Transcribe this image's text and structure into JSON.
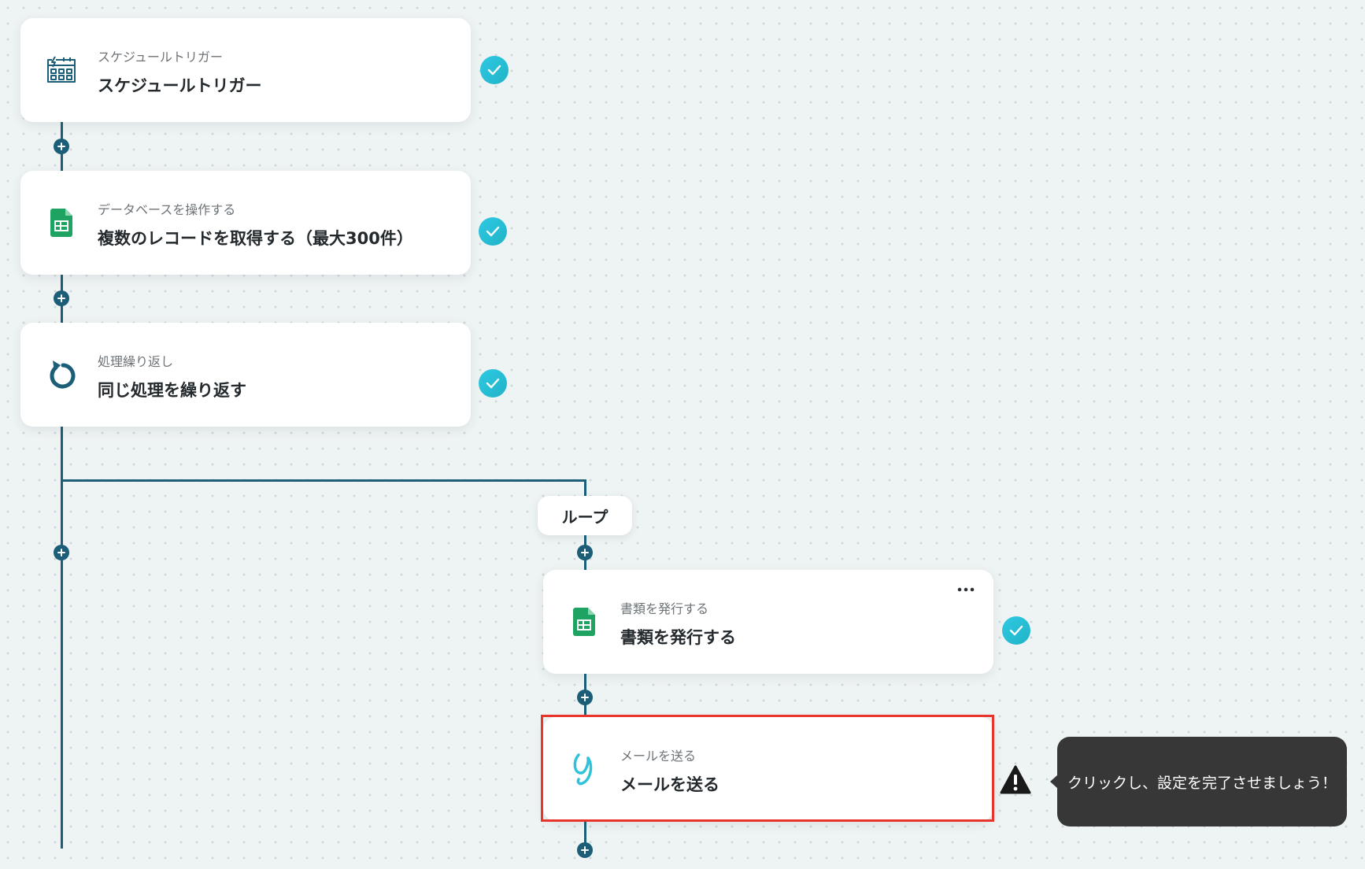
{
  "flow": {
    "steps": [
      {
        "subtitle": "スケジュールトリガー",
        "title": "スケジュールトリガー",
        "icon": "schedule-trigger-icon",
        "status": "complete"
      },
      {
        "subtitle": "データベースを操作する",
        "title": "複数のレコードを取得する（最大300件）",
        "icon": "google-sheets-icon",
        "status": "complete"
      },
      {
        "subtitle": "処理繰り返し",
        "title": "同じ処理を繰り返す",
        "icon": "loop-repeat-icon",
        "status": "complete"
      }
    ],
    "loop": {
      "label": "ループ",
      "steps": [
        {
          "subtitle": "書類を発行する",
          "title": "書類を発行する",
          "icon": "google-sheets-icon",
          "status": "complete"
        },
        {
          "subtitle": "メールを送る",
          "title": "メールを送る",
          "icon": "mail-send-icon",
          "status": "incomplete"
        }
      ]
    }
  },
  "tooltip": {
    "text": "クリックし、設定を完了させましょう！"
  },
  "colors": {
    "connector": "#1c5e78",
    "check": "#21b3c7",
    "sheets": "#1ea362",
    "highlight": "#e8342a",
    "tooltip_bg": "#373737"
  }
}
